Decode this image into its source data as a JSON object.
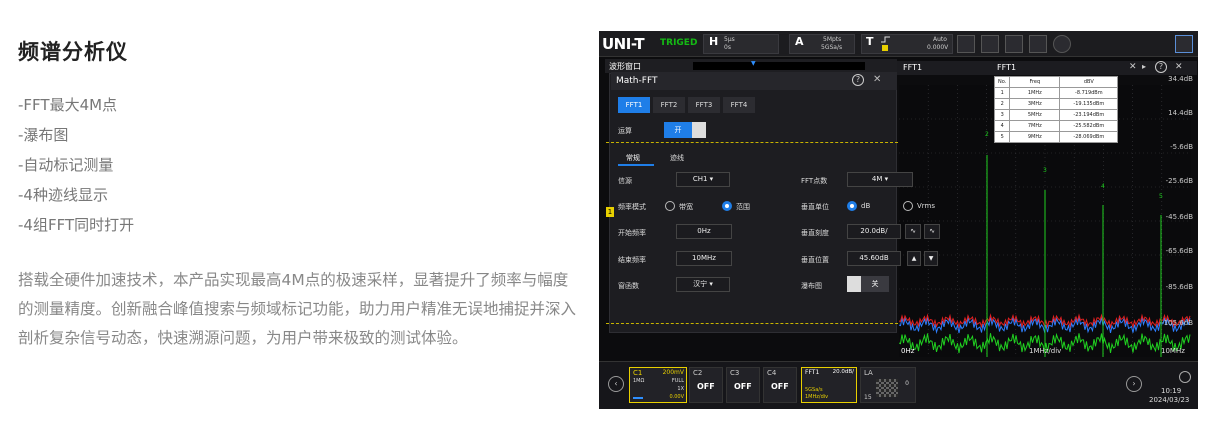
{
  "intro": {
    "title": "频谱分析仪",
    "features": [
      "-FFT最大4M点",
      "-瀑布图",
      "-自动标记测量",
      "-4种迹线显示",
      "-4组FFT同时打开"
    ],
    "description": "搭载全硬件加速技术，本产品实现最高4M点的极速采样，显著提升了频率与幅度的测量精度。创新融合峰值搜索与频域标记功能，助力用户精准无误地捕捉并深入剖析复杂信号动态，快速溯源问题，为用户带来极致的测试体验。"
  },
  "scope": {
    "logo": "UNI-T",
    "trig_status": "TRIGED",
    "h_label": "H",
    "h_scale": "5μs",
    "h_offset": "0s",
    "acq_label": "A",
    "acq_points": "5Mpts",
    "acq_rate": "5GSa/s",
    "trig_label": "T",
    "trig_mode": "Auto",
    "trig_level": "0.000V",
    "window_title": "波形窗口",
    "fft_title": "FFT1",
    "fft_title2": "FFT1",
    "math_title": "Math-FFT",
    "tabs": [
      "FFT1",
      "FFT2",
      "FFT3",
      "FFT4"
    ],
    "op_label": "运算",
    "op_value": "开",
    "subtabs": [
      "常规",
      "迹线"
    ],
    "source_label": "信源",
    "source_value": "CH1",
    "fft_points_label": "FFT点数",
    "fft_points_value": "4M",
    "freq_mode_label": "频率模式",
    "freq_mode_opt1": "带宽",
    "freq_mode_opt2": "范围",
    "vert_unit_label": "垂直单位",
    "vert_unit_opt1": "dB",
    "vert_unit_opt2": "Vrms",
    "start_freq_label": "开始频率",
    "start_freq_value": "0Hz",
    "vert_scale_label": "垂直刻度",
    "vert_scale_value": "20.0dB/",
    "end_freq_label": "结束频率",
    "end_freq_value": "10MHz",
    "vert_pos_label": "垂直位置",
    "vert_pos_value": "45.60dB",
    "window_func_label": "窗函数",
    "window_func_value": "汉宁",
    "waterfall_label": "瀑布图",
    "waterfall_value": "关",
    "marker_table": {
      "headers": [
        "No.",
        "Freq",
        "dBV"
      ],
      "rows": [
        [
          "1",
          "1MHz",
          "-8.719dBm"
        ],
        [
          "2",
          "3MHz",
          "-19.135dBm"
        ],
        [
          "3",
          "5MHz",
          "-23.194dBm"
        ],
        [
          "4",
          "7MHz",
          "-25.582dBm"
        ],
        [
          "5",
          "9MHz",
          "-28.069dBm"
        ]
      ]
    },
    "db_scale": [
      "34.4dB",
      "14.4dB",
      "-5.6dB",
      "-25.6dB",
      "-45.6dB",
      "-65.6dB",
      "-85.6dB",
      "-105.6dB"
    ],
    "marker_numbers": [
      "2",
      "3",
      "4",
      "5"
    ],
    "fft_start_label": "0Hz",
    "fft_mid_label": "1MHz/div",
    "fft_end_label": "10MHz",
    "ch1": {
      "name": "C1",
      "scale": "200mV",
      "imp": "1MΩ",
      "bw": "FULL",
      "probe": "1X",
      "offset": "0.00V"
    },
    "ch2": {
      "name": "C2",
      "state": "OFF"
    },
    "ch3": {
      "name": "C3",
      "state": "OFF"
    },
    "ch4": {
      "name": "C4",
      "state": "OFF"
    },
    "fft1_box": {
      "name": "FFT1",
      "scale": "20.0dB/",
      "rate": "5GSa/s",
      "div": "1MHz/div"
    },
    "la_box": {
      "name": "LA",
      "num1": "0",
      "num2": "15"
    },
    "time": "10:19",
    "date": "2024/03/23"
  }
}
